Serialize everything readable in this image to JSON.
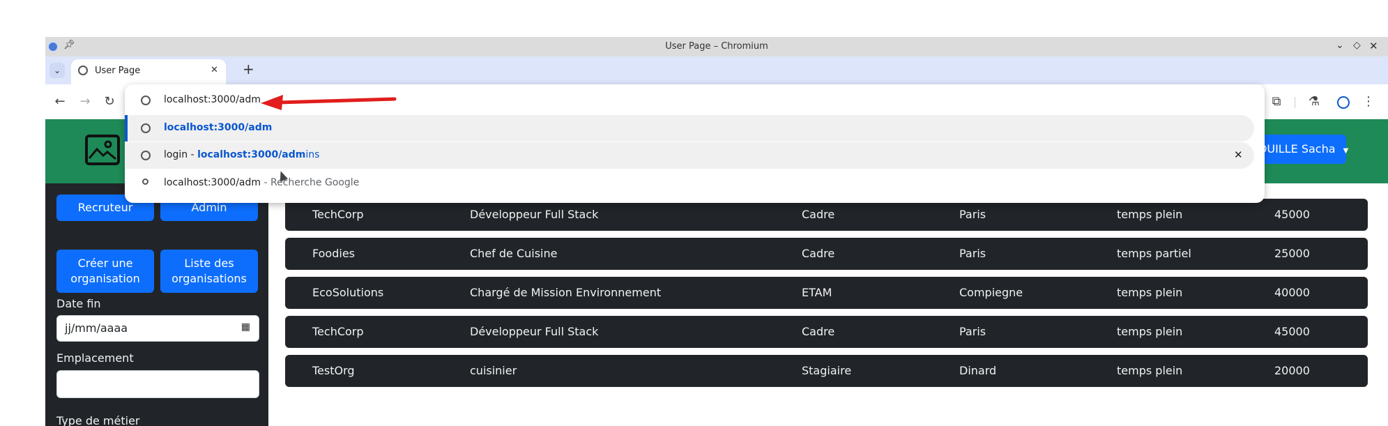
{
  "browser": {
    "window_title": "User Page – Chromium",
    "tab_title": "User Page",
    "new_tab_symbol": "+",
    "tab_close_symbol": "✕"
  },
  "omnibox": {
    "typed_text": "localhost:3000/adm",
    "suggestions": [
      {
        "bold": "localhost:3000/adm",
        "suffix": "",
        "prefix": "",
        "trail": "",
        "icon": "globe-icon"
      },
      {
        "prefix": "login - ",
        "bold": "localhost:3000/adm",
        "suffix": "ins",
        "trail": "",
        "icon": "globe-icon"
      },
      {
        "prefix": "",
        "bold": "",
        "suffix": "localhost:3000/adm",
        "trail": " - Recherche Google",
        "icon": "search-icon"
      }
    ],
    "remove_symbol": "✕"
  },
  "header": {
    "user_menu_label": "TOUILLE Sacha"
  },
  "sidebar": {
    "btn_recruteur": "Recruteur",
    "btn_admin": "Admin",
    "btn_creer_line1": "Créer une",
    "btn_creer_line2": "organisation",
    "btn_liste_line1": "Liste des",
    "btn_liste_line2": "organisations",
    "label_date_fin": "Date fin",
    "date_placeholder": "jj/mm/aaaa",
    "label_emplacement": "Emplacement",
    "label_type_metier": "Type de métier"
  },
  "offers": [
    {
      "org": "TechCorp",
      "title": "Développeur Full Stack",
      "status": "Cadre",
      "city": "Paris",
      "time": "temps plein",
      "salary": "45000"
    },
    {
      "org": "Foodies",
      "title": "Chef de Cuisine",
      "status": "Cadre",
      "city": "Paris",
      "time": "temps partiel",
      "salary": "25000"
    },
    {
      "org": "EcoSolutions",
      "title": "Chargé de Mission Environnement",
      "status": "ETAM",
      "city": "Compiegne",
      "time": "temps plein",
      "salary": "40000"
    },
    {
      "org": "TechCorp",
      "title": "Développeur Full Stack",
      "status": "Cadre",
      "city": "Paris",
      "time": "temps plein",
      "salary": "45000"
    },
    {
      "org": "TestOrg",
      "title": "cuisinier",
      "status": "Stagiaire",
      "city": "Dinard",
      "time": "temps plein",
      "salary": "20000"
    }
  ],
  "colors": {
    "header_green": "#1e8a57",
    "sidebar_dark": "#212529",
    "primary_blue": "#0d6efd",
    "arrow_red": "#e11d1d",
    "suggestion_blue": "#0b57d0"
  }
}
